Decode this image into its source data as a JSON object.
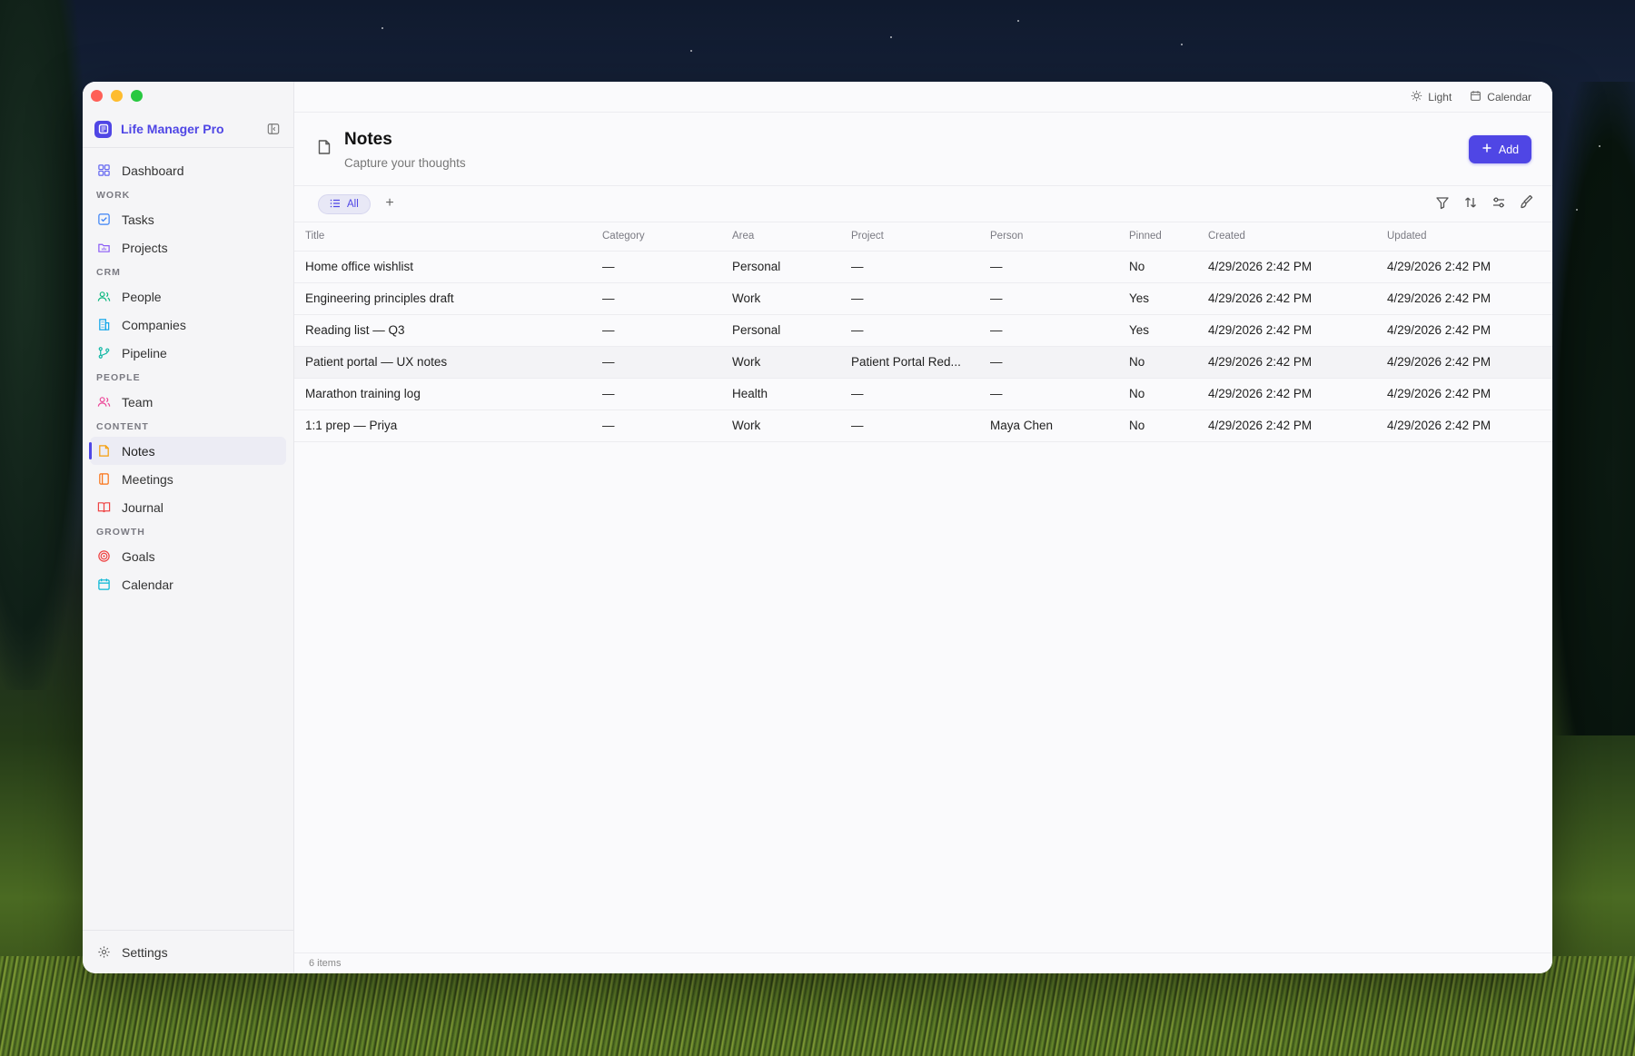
{
  "app": {
    "name": "Life Manager Pro"
  },
  "colors": {
    "accent": "#4f46e5",
    "traffic_red": "#fe5f57",
    "traffic_yellow": "#febc2e",
    "traffic_green": "#28c840"
  },
  "sidebar": {
    "dashboard": {
      "label": "Dashboard",
      "icon": "grid-icon"
    },
    "sections": {
      "work": "WORK",
      "crm": "CRM",
      "people": "PEOPLE",
      "content": "CONTENT",
      "growth": "GROWTH"
    },
    "items": {
      "tasks": {
        "label": "Tasks",
        "icon": "checkbox-icon"
      },
      "projects": {
        "label": "Projects",
        "icon": "folder-icon"
      },
      "people": {
        "label": "People",
        "icon": "users-icon"
      },
      "companies": {
        "label": "Companies",
        "icon": "building-icon"
      },
      "pipeline": {
        "label": "Pipeline",
        "icon": "git-branch-icon"
      },
      "team": {
        "label": "Team",
        "icon": "team-icon"
      },
      "notes": {
        "label": "Notes",
        "icon": "note-icon",
        "active": true
      },
      "meetings": {
        "label": "Meetings",
        "icon": "notebook-icon"
      },
      "journal": {
        "label": "Journal",
        "icon": "book-icon"
      },
      "goals": {
        "label": "Goals",
        "icon": "target-icon"
      },
      "calendar": {
        "label": "Calendar",
        "icon": "calendar-icon"
      }
    },
    "settings": {
      "label": "Settings",
      "icon": "gear-icon"
    }
  },
  "topbar": {
    "theme_label": "Light",
    "calendar_label": "Calendar"
  },
  "page": {
    "title": "Notes",
    "subtitle": "Capture your thoughts",
    "add_label": "Add"
  },
  "toolbar": {
    "view_label": "All",
    "add_view": "+"
  },
  "table": {
    "columns": [
      "Title",
      "Category",
      "Area",
      "Project",
      "Person",
      "Pinned",
      "Created",
      "Updated"
    ],
    "rows": [
      [
        "Home office wishlist",
        "—",
        "Personal",
        "—",
        "—",
        "No",
        "4/29/2026 2:42 PM",
        "4/29/2026 2:42 PM"
      ],
      [
        "Engineering principles draft",
        "—",
        "Work",
        "—",
        "—",
        "Yes",
        "4/29/2026 2:42 PM",
        "4/29/2026 2:42 PM"
      ],
      [
        "Reading list — Q3",
        "—",
        "Personal",
        "—",
        "—",
        "Yes",
        "4/29/2026 2:42 PM",
        "4/29/2026 2:42 PM"
      ],
      [
        "Patient portal — UX notes",
        "—",
        "Work",
        "Patient Portal Red...",
        "—",
        "No",
        "4/29/2026 2:42 PM",
        "4/29/2026 2:42 PM"
      ],
      [
        "Marathon training log",
        "—",
        "Health",
        "—",
        "—",
        "No",
        "4/29/2026 2:42 PM",
        "4/29/2026 2:42 PM"
      ],
      [
        "1:1 prep — Priya",
        "—",
        "Work",
        "—",
        "Maya Chen",
        "No",
        "4/29/2026 2:42 PM",
        "4/29/2026 2:42 PM"
      ]
    ]
  },
  "footer": {
    "count_label": "6 items"
  }
}
